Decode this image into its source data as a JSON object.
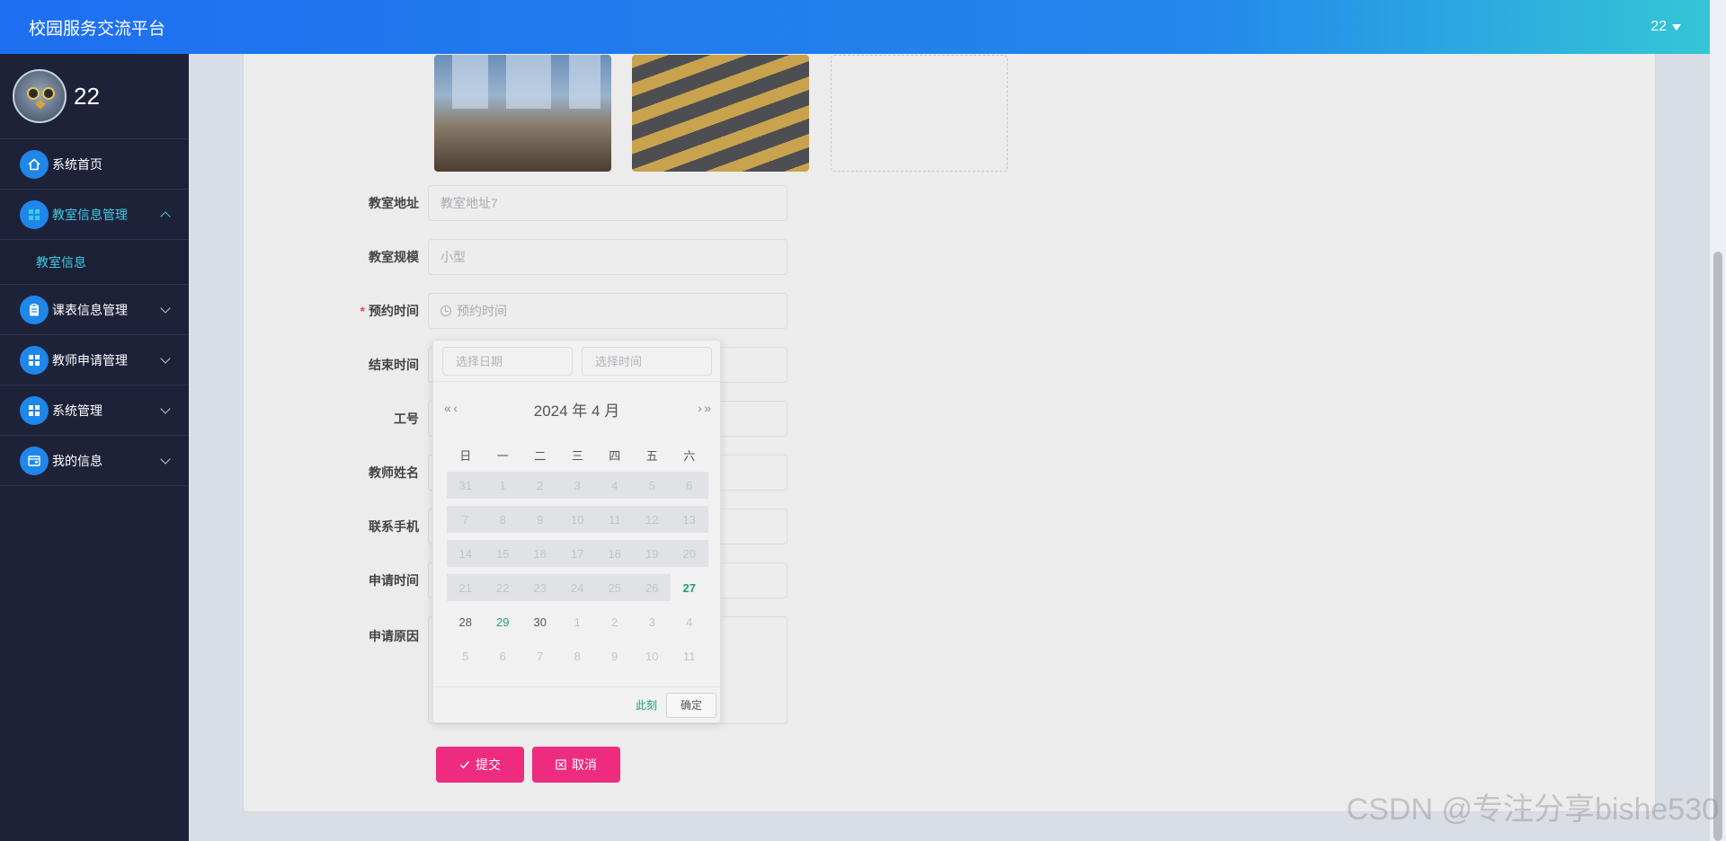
{
  "app": {
    "title": "校园服务交流平台",
    "user_label": "22"
  },
  "sidebar": {
    "username": "22",
    "items": [
      {
        "label": "系统首页",
        "icon": "home-icon"
      },
      {
        "label": "教室信息管理",
        "icon": "grid-icon"
      },
      {
        "label": "课表信息管理",
        "icon": "clipboard-icon"
      },
      {
        "label": "教师申请管理",
        "icon": "grid-icon"
      },
      {
        "label": "系统管理",
        "icon": "grid-icon"
      },
      {
        "label": "我的信息",
        "icon": "id-card-icon"
      }
    ],
    "sub_item": "教室信息"
  },
  "form": {
    "address_label": "教室地址",
    "address_value": "教室地址7",
    "size_label": "教室规模",
    "size_value": "小型",
    "reserve_label": "预约时间",
    "reserve_placeholder": "预约时间",
    "end_label": "结束时间",
    "id_label": "工号",
    "teacher_label": "教师姓名",
    "phone_label": "联系手机",
    "apply_time_label": "申请时间",
    "reason_label": "申请原因",
    "required_mark": "*",
    "submit_label": "提交",
    "cancel_label": "取消"
  },
  "picker": {
    "date_placeholder": "选择日期",
    "time_placeholder": "选择时间",
    "prev_year": "«",
    "prev_month": "‹",
    "next_month": "›",
    "next_year": "»",
    "year_month": "2024 年  4 月",
    "weekdays": [
      "日",
      "一",
      "二",
      "三",
      "四",
      "五",
      "六"
    ],
    "weeks": [
      [
        "31",
        "1",
        "2",
        "3",
        "4",
        "5",
        "6"
      ],
      [
        "7",
        "8",
        "9",
        "10",
        "11",
        "12",
        "13"
      ],
      [
        "14",
        "15",
        "16",
        "17",
        "18",
        "19",
        "20"
      ],
      [
        "21",
        "22",
        "23",
        "24",
        "25",
        "26",
        "27"
      ],
      [
        "28",
        "29",
        "30",
        "1",
        "2",
        "3",
        "4"
      ],
      [
        "5",
        "6",
        "7",
        "8",
        "9",
        "10",
        "11"
      ]
    ],
    "today": "27",
    "highlight": "29",
    "now_label": "此刻",
    "ok_label": "确定"
  },
  "watermark": "CSDN @专注分享bishe530",
  "colors": {
    "accent_pink": "#ee2c7f",
    "sidebar_bg": "#1e2239",
    "active_cyan": "#3ecbe4",
    "today_green": "#22a06b"
  }
}
